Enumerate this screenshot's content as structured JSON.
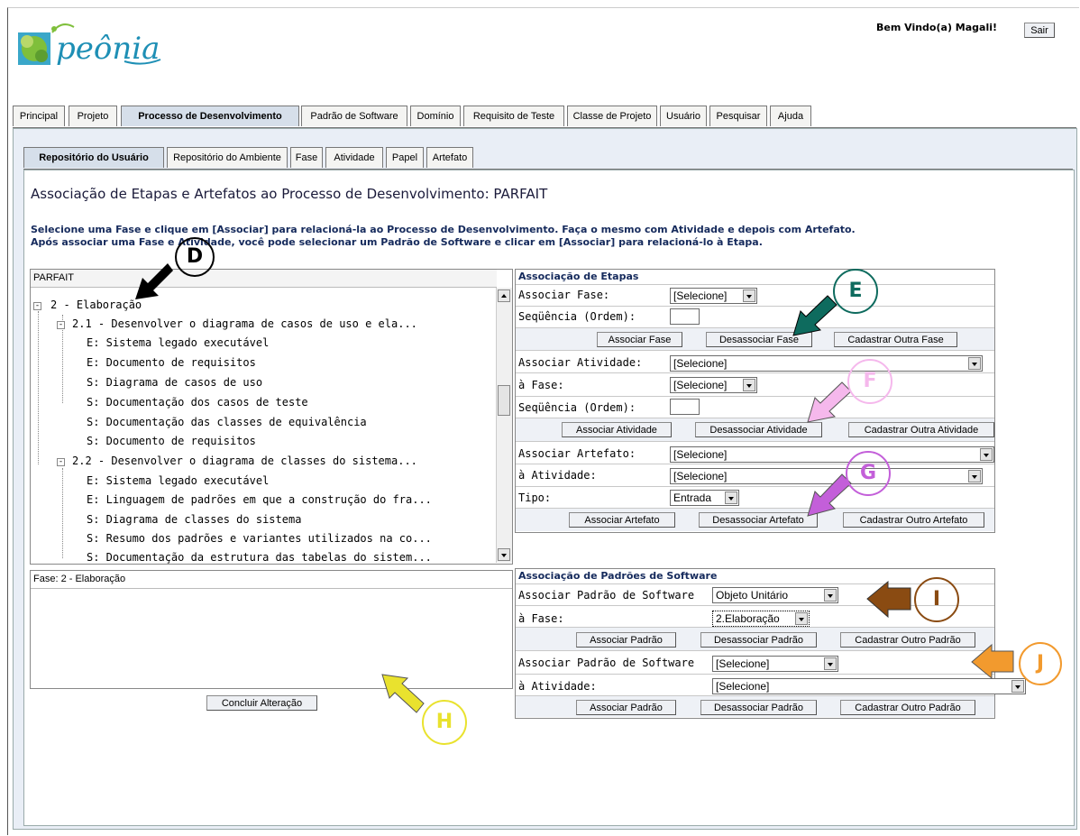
{
  "header": {
    "logo_text": "peônia",
    "welcome": "Bem Vindo(a) Magali!",
    "logout_label": "Sair"
  },
  "main_tabs": [
    {
      "label": "Principal"
    },
    {
      "label": "Projeto"
    },
    {
      "label": "Processo de Desenvolvimento",
      "active": true
    },
    {
      "label": "Padrão de Software"
    },
    {
      "label": "Domínio"
    },
    {
      "label": "Requisito de Teste"
    },
    {
      "label": "Classe de Projeto"
    },
    {
      "label": "Usuário"
    },
    {
      "label": "Pesquisar"
    },
    {
      "label": "Ajuda"
    }
  ],
  "sub_tabs": [
    {
      "label": "Repositório do Usuário",
      "active": true
    },
    {
      "label": "Repositório do Ambiente"
    },
    {
      "label": "Fase"
    },
    {
      "label": "Atividade"
    },
    {
      "label": "Papel"
    },
    {
      "label": "Artefato"
    }
  ],
  "page": {
    "title": "Associação de Etapas e Artefatos ao Processo de Desenvolvimento: PARFAIT",
    "instructions_1": "Selecione uma Fase e clique em [Associar] para relacioná-la ao Processo de Desenvolvimento. Faça o mesmo com Atividade e depois com Artefato.",
    "instructions_2": "Após associar uma Fase e Atividade, você pode selecionar um Padrão de Software e clicar em [Associar] para relacioná-lo à Etapa."
  },
  "tree": {
    "header": "PARFAIT",
    "root": "2 - Elaboração",
    "items": [
      {
        "text": "2.1 - Desenvolver o diagrama de casos de uso e ela...",
        "level": 1
      },
      {
        "text": "E: Sistema legado executável",
        "level": 2
      },
      {
        "text": "E: Documento de requisitos",
        "level": 2
      },
      {
        "text": "S: Diagrama de casos de uso",
        "level": 2
      },
      {
        "text": "S: Documentação dos casos de teste",
        "level": 2
      },
      {
        "text": "S: Documentação das classes de equivalência",
        "level": 2
      },
      {
        "text": "S: Documento de requisitos",
        "level": 2
      },
      {
        "text": "2.2 - Desenvolver o diagrama de classes do sistema...",
        "level": 1
      },
      {
        "text": "E: Sistema legado executável",
        "level": 2
      },
      {
        "text": "E: Linguagem de padrões em que a construção do fra...",
        "level": 2
      },
      {
        "text": "S: Diagrama de classes do sistema",
        "level": 2
      },
      {
        "text": "S: Resumo dos padrões e variantes utilizados na co...",
        "level": 2
      },
      {
        "text": "S: Documentação da estrutura das tabelas do sistem...",
        "level": 2
      }
    ]
  },
  "detail": {
    "header": "Fase: 2 - Elaboração",
    "button": "Concluir Alteração"
  },
  "etapas": {
    "title": "Associação de Etapas",
    "associar_fase": "Associar Fase:",
    "fase_select": "[Selecione]",
    "sequencia": "Seqüência (Ordem):",
    "btn_assoc_fase": "Associar Fase",
    "btn_desassoc_fase": "Desassociar Fase",
    "btn_cad_fase": "Cadastrar Outra Fase",
    "associar_atividade": "Associar Atividade:",
    "atividade_select": "[Selecione]",
    "a_fase": "à Fase:",
    "a_fase_select": "[Selecione]",
    "sequencia2": "Seqüência (Ordem):",
    "btn_assoc_ativ": "Associar Atividade",
    "btn_desassoc_ativ": "Desassociar Atividade",
    "btn_cad_ativ": "Cadastrar Outra Atividade",
    "associar_artefato": "Associar Artefato:",
    "artefato_select": "[Selecione]",
    "a_atividade": "à Atividade:",
    "a_atividade_select": "[Selecione]",
    "tipo": "Tipo:",
    "tipo_select": "Entrada",
    "btn_assoc_art": "Associar Artefato",
    "btn_desassoc_art": "Desassociar Artefato",
    "btn_cad_art": "Cadastrar Outro Artefato"
  },
  "padroes": {
    "title": "Associação de Padrões de Software",
    "assoc_padrao_1": "Associar Padrão de Software",
    "padrao_select_1": "Objeto Unitário",
    "a_fase": "à Fase:",
    "fase_select": "2.Elaboração",
    "btn_assoc_1": "Associar Padrão",
    "btn_desassoc_1": "Desassociar Padrão",
    "btn_cad_1": "Cadastrar Outro Padrão",
    "assoc_padrao_2": "Associar Padrão de Software",
    "padrao_select_2": "[Selecione]",
    "a_atividade": "à Atividade:",
    "atividade_select": "[Selecione]",
    "btn_assoc_2": "Associar Padrão",
    "btn_desassoc_2": "Desassociar Padrão",
    "btn_cad_2": "Cadastrar Outro Padrão"
  },
  "annotations": {
    "D": "D",
    "E": "E",
    "F": "F",
    "G": "G",
    "H": "H",
    "I": "I",
    "J": "J",
    "colors": {
      "D": "#000000",
      "E": "#0e6b5e",
      "F": "#f5b8ec",
      "G": "#c35fd9",
      "H": "#e9e22e",
      "I": "#8a4b12",
      "J": "#f29a2e"
    }
  }
}
